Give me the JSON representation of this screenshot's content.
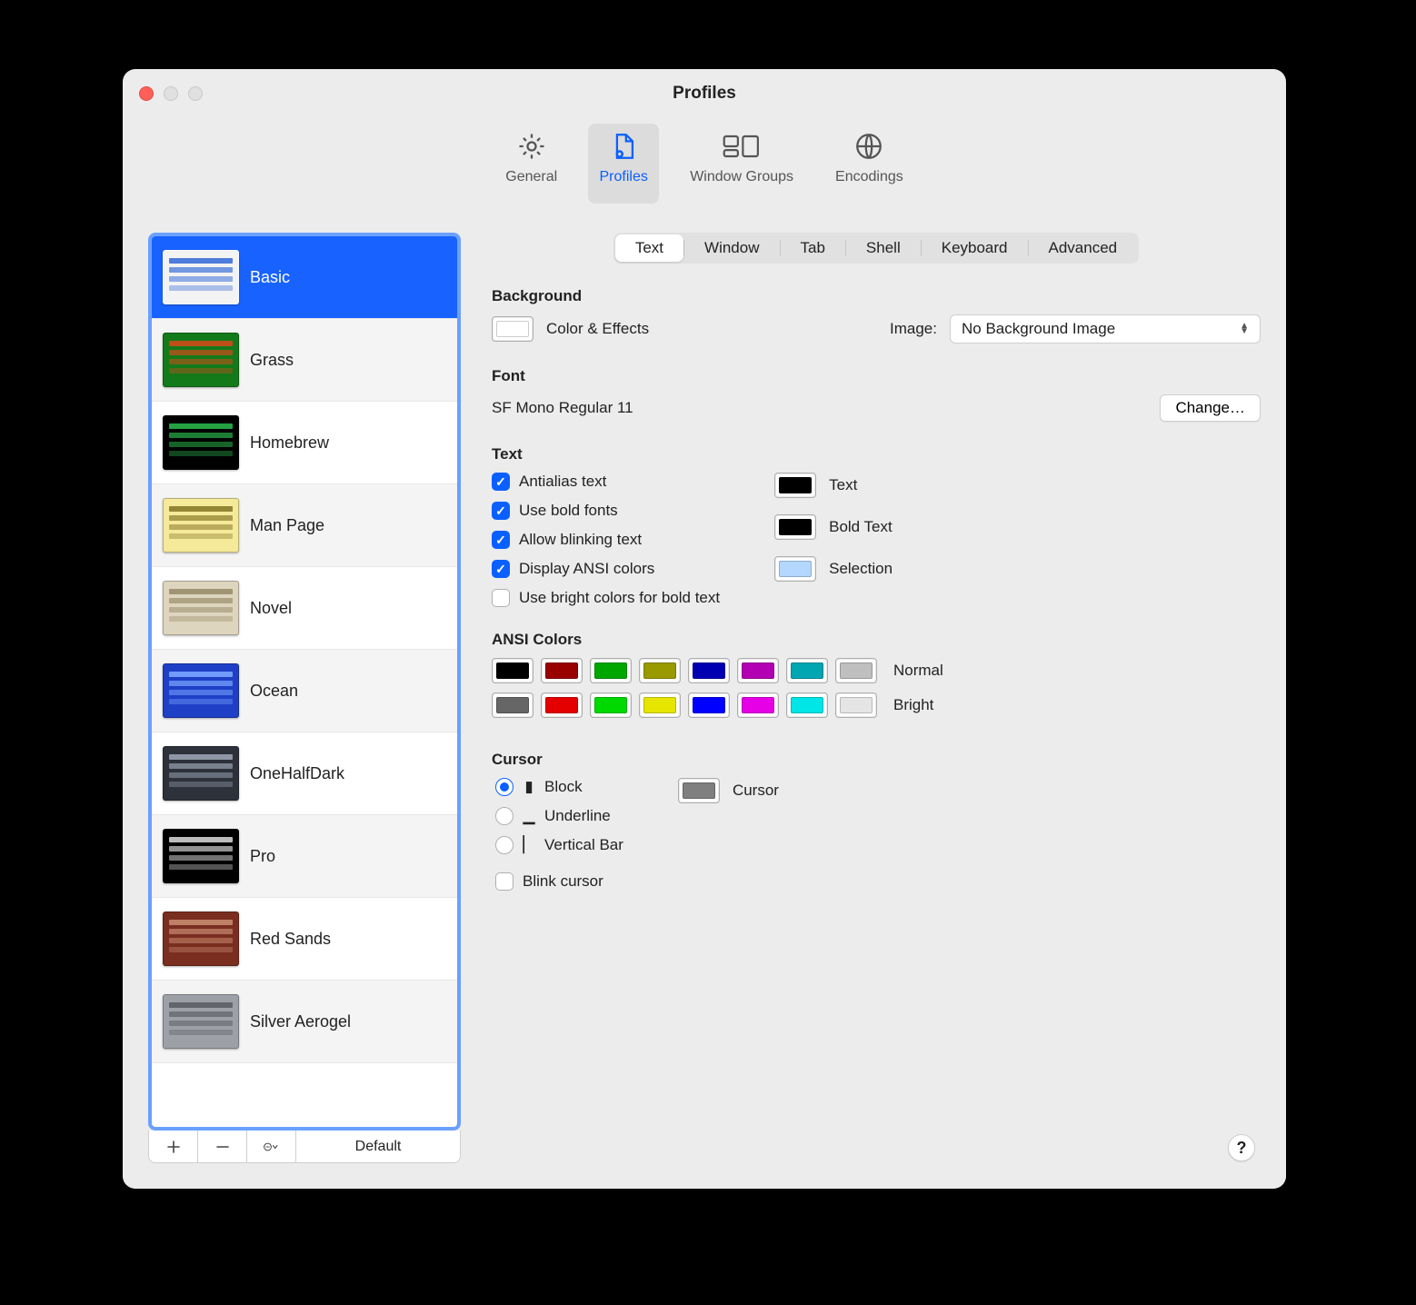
{
  "window": {
    "title": "Profiles"
  },
  "toolbar": {
    "items": [
      {
        "label": "General"
      },
      {
        "label": "Profiles"
      },
      {
        "label": "Window Groups"
      },
      {
        "label": "Encodings"
      }
    ],
    "selected": 1
  },
  "sidebar": {
    "profiles": [
      {
        "name": "Basic",
        "bg": "#f3f3f3",
        "ink": "#3b6fd8"
      },
      {
        "name": "Grass",
        "bg": "#137a1a",
        "ink": "#d04a1a"
      },
      {
        "name": "Homebrew",
        "bg": "#000000",
        "ink": "#29b24a"
      },
      {
        "name": "Man Page",
        "bg": "#f5e99a",
        "ink": "#8a7a2a"
      },
      {
        "name": "Novel",
        "bg": "#ded5bf",
        "ink": "#9a8d6a"
      },
      {
        "name": "Ocean",
        "bg": "#1f3fc7",
        "ink": "#7aa6ff"
      },
      {
        "name": "OneHalfDark",
        "bg": "#2c313a",
        "ink": "#9aa3b2"
      },
      {
        "name": "Pro",
        "bg": "#000000",
        "ink": "#d0d0d0"
      },
      {
        "name": "Red Sands",
        "bg": "#7a2e20",
        "ink": "#c78a70"
      },
      {
        "name": "Silver Aerogel",
        "bg": "#9da0a6",
        "ink": "#5c5f66"
      }
    ],
    "selected": 0,
    "default_label": "Default"
  },
  "subtabs": {
    "items": [
      "Text",
      "Window",
      "Tab",
      "Shell",
      "Keyboard",
      "Advanced"
    ],
    "selected": 0
  },
  "sections": {
    "background": {
      "title": "Background",
      "color_effects_label": "Color & Effects",
      "color": "#ffffff",
      "image_label": "Image:",
      "image_value": "No Background Image"
    },
    "font": {
      "title": "Font",
      "value": "SF Mono Regular 11",
      "change_label": "Change…"
    },
    "text": {
      "title": "Text",
      "antialias": "Antialias text",
      "bold_fonts": "Use bold fonts",
      "blinking": "Allow blinking text",
      "ansi": "Display ANSI colors",
      "bright_bold": "Use bright colors for bold text",
      "labels": {
        "text": "Text",
        "bold": "Bold Text",
        "selection": "Selection"
      },
      "colors": {
        "text": "#000000",
        "bold": "#000000",
        "selection": "#b3d7ff"
      }
    },
    "ansi": {
      "title": "ANSI Colors",
      "normal_label": "Normal",
      "bright_label": "Bright",
      "normal": [
        "#000000",
        "#990000",
        "#00a600",
        "#999900",
        "#0000b2",
        "#b200b2",
        "#00a6b2",
        "#bfbfbf"
      ],
      "bright": [
        "#666666",
        "#e50000",
        "#00d900",
        "#e5e500",
        "#0000ff",
        "#e500e5",
        "#00e5e5",
        "#e5e5e5"
      ]
    },
    "cursor": {
      "title": "Cursor",
      "block": "Block",
      "underline": "Underline",
      "vertical": "Vertical Bar",
      "blink": "Blink cursor",
      "label": "Cursor",
      "color": "#7f7f7f"
    }
  },
  "help": "?"
}
